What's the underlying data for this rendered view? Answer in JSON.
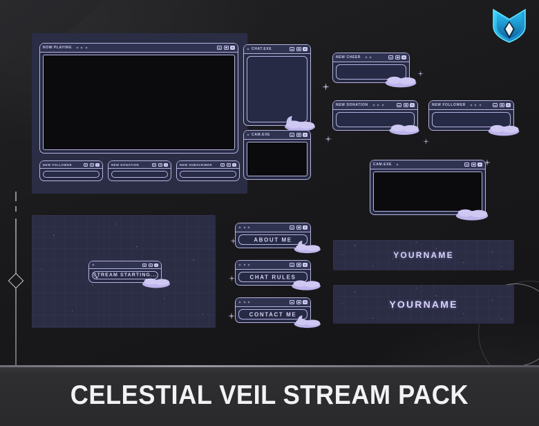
{
  "page": {
    "title": "CELESTIAL VEIL STREAM PACK",
    "accent_border": "#b8b4e0",
    "panel_bg": "#2b2d45",
    "screen_bg": "#0b0b0e",
    "banner_bottom_bg": "#2e2e30"
  },
  "logo": {
    "name": "shield-diamond-logo",
    "colors": [
      "#25c3f0",
      "#1a86c8",
      "#ffffff"
    ]
  },
  "window_controls": {
    "minimize": "minimize",
    "maximize": "maximize",
    "close": "close"
  },
  "main_layout": {
    "label": "NOW PLAYING",
    "stars": 3,
    "alerts": [
      {
        "label": "NEW FOLLOWER"
      },
      {
        "label": "NEW DONATION"
      },
      {
        "label": "NEW SUBSCRIBER"
      }
    ]
  },
  "side_windows": [
    {
      "label": "CHAT.EXE",
      "stars": 1
    },
    {
      "label": "CAM.EXE",
      "stars": 1
    }
  ],
  "alert_panels": [
    {
      "label": "NEW CHEER",
      "stars": 2
    },
    {
      "label": "NEW DONATION",
      "stars": 3
    },
    {
      "label": "NEW FOLLOWER",
      "stars": 3
    }
  ],
  "cam_window": {
    "label": "CAM.EXE",
    "stars": 1
  },
  "starting_screen": {
    "label": "STREAM STARTING...",
    "stars": 1
  },
  "info_panels": [
    {
      "label": "ABOUT ME",
      "stars": 3
    },
    {
      "label": "CHAT RULES",
      "stars": 3
    },
    {
      "label": "CONTACT ME",
      "stars": 3
    }
  ],
  "banners": [
    {
      "label": "YOURNAME"
    },
    {
      "label": "YOURNAME"
    }
  ]
}
